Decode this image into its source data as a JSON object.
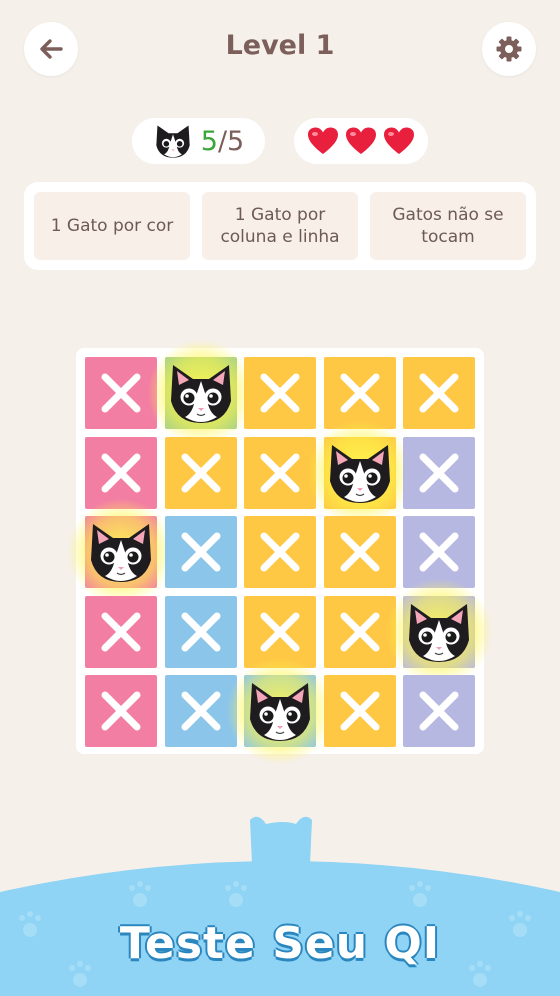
{
  "header": {
    "title": "Level 1",
    "back_icon": "arrow-left-icon",
    "settings_icon": "gear-icon"
  },
  "status": {
    "cats_found": "5",
    "cats_total": "/5",
    "lives": 3,
    "life_icon": "heart-icon"
  },
  "rules": [
    {
      "label": "1 Gato por cor"
    },
    {
      "label": "1 Gato por coluna e linha"
    },
    {
      "label": "Gatos não se tocam"
    }
  ],
  "colors": {
    "pink": "#f27fa3",
    "yellow": "#fec845",
    "blue": "#8cc5ea",
    "lavender": "#b7b8e2",
    "green": "#a4d08c",
    "accent_text": "#7c5f5a",
    "score_green": "#3aa63a",
    "heart": "#e8203d",
    "banner_blue": "#8fd3f5"
  },
  "board": {
    "rows": 5,
    "cols": 5,
    "cells": [
      [
        "pink",
        "green",
        "yellow",
        "yellow",
        "yellow"
      ],
      [
        "pink",
        "yellow",
        "yellow",
        "yellow",
        "lavender"
      ],
      [
        "pink",
        "blue",
        "yellow",
        "yellow",
        "lavender"
      ],
      [
        "pink",
        "blue",
        "yellow",
        "yellow",
        "lavender"
      ],
      [
        "pink",
        "blue",
        "blue",
        "yellow",
        "lavender"
      ]
    ],
    "cats": [
      [
        0,
        1
      ],
      [
        1,
        3
      ],
      [
        2,
        0
      ],
      [
        3,
        4
      ],
      [
        4,
        2
      ]
    ]
  },
  "banner": {
    "text": "Teste Seu QI"
  }
}
